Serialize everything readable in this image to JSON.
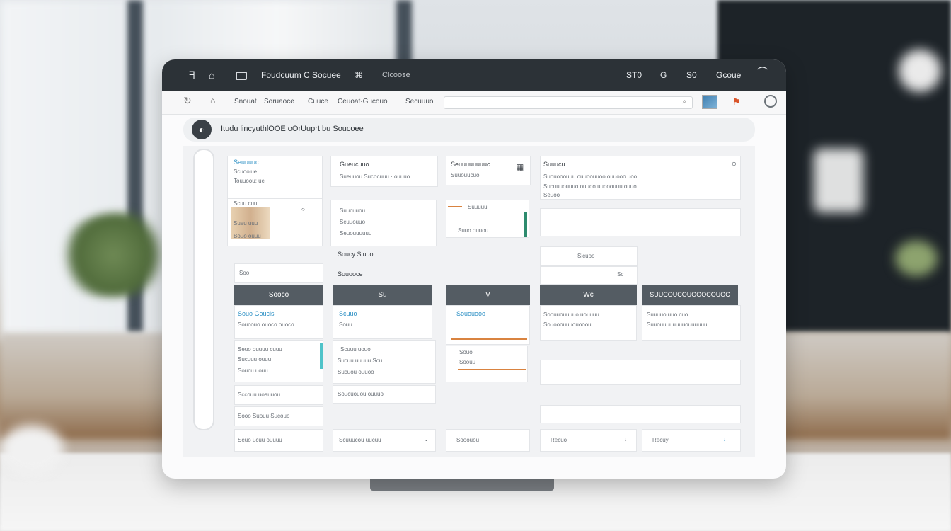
{
  "titlebar": {
    "left_icons": [
      "back-icon",
      "home-icon",
      "window-icon"
    ],
    "app_title": "Foudcuum C Socuee",
    "link_icon": "link-icon",
    "subtitle": "Clcoose",
    "right_items": [
      "ST0",
      "G",
      "S0",
      "Gcoue"
    ],
    "profile_icon": "profile-icon"
  },
  "toolbar": {
    "items": [
      "Snouat",
      "Soruaoce",
      "Cuuce",
      "Ceuoat·Gucouo",
      "Secuuuo"
    ],
    "search_value": "",
    "search_icon": "search-icon"
  },
  "breadcrumb": "Itudu lincyuthlOOE  oOrUuprt bu Soucoee",
  "columns": [
    {
      "cards": [
        {
          "title": "Seuuuuc",
          "lines": [
            "Scuoo'ue",
            "Touuoou: uc"
          ]
        },
        {
          "lines": [
            "Scuu cuu",
            "Sueu uuu",
            "Bouo ouuu"
          ]
        },
        {
          "lines": [
            "Soo"
          ]
        }
      ],
      "header": "Sooco",
      "sections": [
        {
          "title": "Souo Goucis",
          "lines": [
            "Soucouo ouoco ouoco"
          ]
        },
        {
          "lines": [
            "Seuo ouuuu cuuu",
            "Sucuuu ouuu",
            "Soucu uouu"
          ]
        },
        {
          "lines": [
            "Sccouu uoauuou"
          ]
        },
        {
          "lines": [
            "Sooo Suouu Sucouo"
          ]
        }
      ],
      "footer": "Seuo ucuu ouuuu"
    },
    {
      "cards": [
        {
          "title": "Gueucuuo",
          "lines": [
            "Sueuuou Sucocuuu · ouuuo"
          ]
        },
        {
          "lines": [
            "Suucuuou",
            "Scuuouuo",
            "Seuouuuuuu"
          ]
        }
      ],
      "subtitles": [
        "Soucy Siuuo",
        "Souooce"
      ],
      "header": "Su",
      "sections": [
        {
          "title": "Scuuo",
          "lines": [
            "Souu"
          ]
        },
        {
          "lines": [
            "Scuuu uouo",
            "Sucuu uuuuu Scu",
            "Sucuou ouuoo"
          ]
        },
        {
          "lines": [
            "Soucuouou ouuuo"
          ]
        }
      ],
      "footer": "Scuuucou uucuu"
    },
    {
      "cards": [
        {
          "title": "Seuuuuuuuuc",
          "lines": [
            "Suuouucuo"
          ]
        },
        {
          "lines": [
            "Suuuuu"
          ]
        },
        {
          "lines": [
            "Suuo ouuou"
          ]
        }
      ],
      "header": "V",
      "sections": [
        {
          "title": "Sououooo",
          "lines": []
        },
        {
          "lines": [
            "Souo",
            "Soouu"
          ]
        }
      ],
      "footer": "Sooouou"
    },
    {
      "cards": [
        {
          "title": "Suuucu",
          "lines": [
            "Suouooouuu ouuoouuoo ouuooo uoo",
            "Sucuuuouuuo ouuoo uuooouuu ouuo",
            "Seuoo"
          ]
        }
      ],
      "subtitles": [
        "Sicuoo",
        "Sc"
      ],
      "header": "Wc",
      "sections": [
        {
          "lines": [
            "Soouuouuuuo uouuuu",
            "Souooouuuouooou"
          ]
        }
      ],
      "footer": "Recuo"
    },
    {
      "header": "SUUCOUCOUOOOCOUOC",
      "sections": [
        {
          "lines": [
            "Suuuuo uuo cuo",
            "Suuouuuuuuuuouuuuuu"
          ]
        }
      ],
      "footer": "Recuy"
    }
  ],
  "colors": {
    "titlebar": "#2c3237",
    "column_header": "#545c63",
    "accent_blue": "#2b8fc4",
    "accent_orange": "#d98340",
    "accent_teal": "#4fc3c9",
    "accent_green": "#2e8b6e"
  }
}
